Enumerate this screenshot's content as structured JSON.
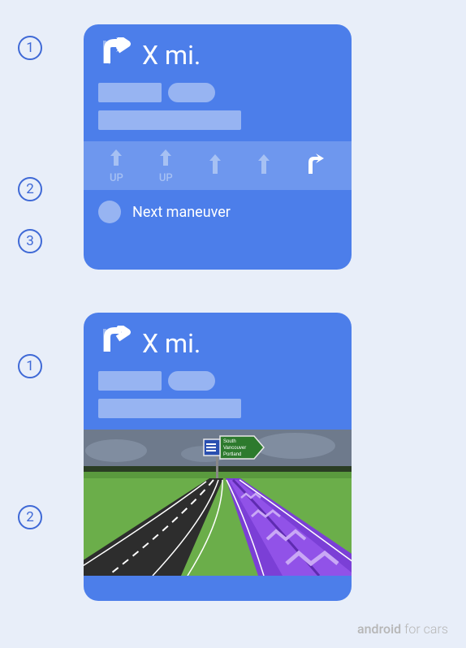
{
  "card1": {
    "distance": "X mi.",
    "lanes": [
      {
        "type": "up",
        "label": "UP",
        "highlight": false
      },
      {
        "type": "up",
        "label": "UP",
        "highlight": false
      },
      {
        "type": "up",
        "label": "",
        "highlight": false
      },
      {
        "type": "up",
        "label": "",
        "highlight": false
      },
      {
        "type": "right",
        "label": "",
        "highlight": true
      }
    ],
    "next_maneuver": "Next maneuver"
  },
  "card2": {
    "distance": "X mi.",
    "junction_sign": {
      "direction": "South",
      "city1": "Vancouver",
      "city2": "Portland"
    }
  },
  "annotations": {
    "card1": [
      "1",
      "2",
      "3"
    ],
    "card2": [
      "1",
      "2"
    ]
  },
  "watermark": {
    "brand": "android",
    "suffix": " for cars"
  }
}
